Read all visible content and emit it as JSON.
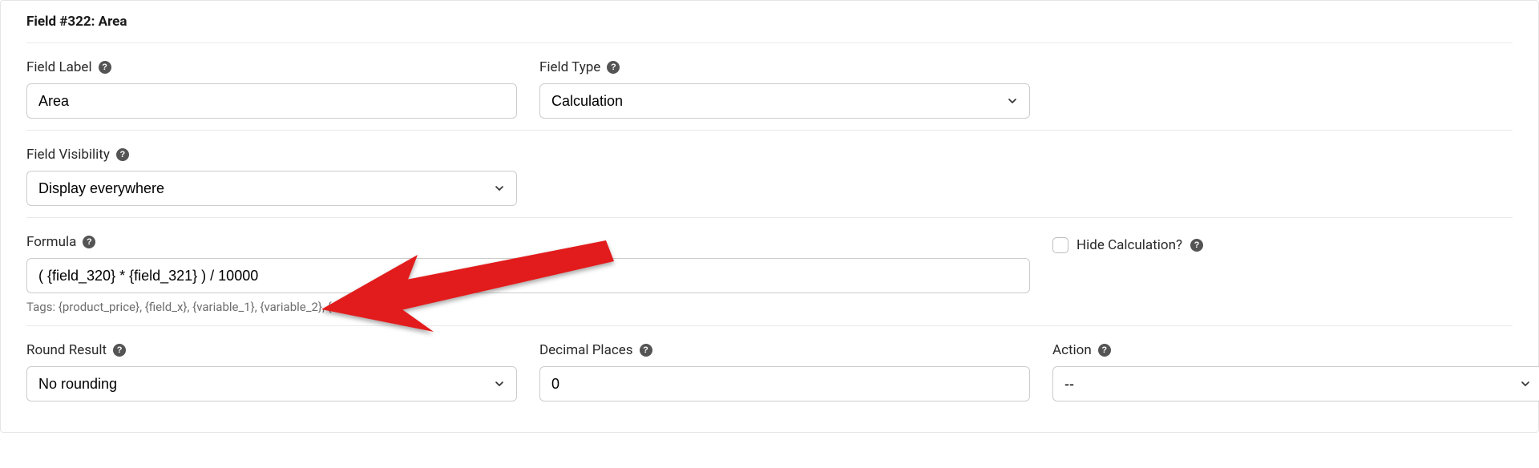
{
  "panel": {
    "title": "Field #322: Area"
  },
  "fieldLabel": {
    "label": "Field Label",
    "value": "Area"
  },
  "fieldType": {
    "label": "Field Type",
    "selected": "Calculation"
  },
  "fieldVisibility": {
    "label": "Field Visibility",
    "selected": "Display everywhere"
  },
  "formula": {
    "label": "Formula",
    "value": "( {field_320} * {field_321} ) / 10000",
    "tags_hint": "Tags: {product_price}, {field_x}, {variable_1}, {variable_2}, {variable_3}"
  },
  "hideCalculation": {
    "label": "Hide Calculation?"
  },
  "roundResult": {
    "label": "Round Result",
    "selected": "No rounding"
  },
  "decimalPlaces": {
    "label": "Decimal Places",
    "value": "0"
  },
  "action": {
    "label": "Action",
    "selected": "--"
  }
}
